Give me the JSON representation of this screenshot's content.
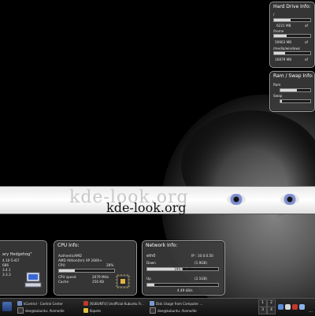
{
  "wallpaper": {
    "ghost_text": "kde-look.org",
    "text": "kde-look.org"
  },
  "hdd": {
    "title": "Hard Drive Info:",
    "rows": [
      {
        "name": "/",
        "value": "6221 MB",
        "unit": "of",
        "fill": 0.45
      },
      {
        "name": "/home",
        "value": "50663 MB",
        "unit": "of",
        "fill": 0.35
      },
      {
        "name": "/media/windows",
        "value": "16879 MB",
        "unit": "of",
        "fill": 0.3
      }
    ]
  },
  "ram": {
    "title": "Ram / Swap Info:",
    "rows": [
      {
        "name": "Ram",
        "fill": 0.55
      },
      {
        "name": "Swap",
        "fill": 0.05
      }
    ]
  },
  "system": {
    "lines": [
      "ary Hedgehog\"",
      "4.10-5-i67",
      "686",
      "3.4.1",
      "3.3.3"
    ]
  },
  "cpu": {
    "title": "CPU Info:",
    "vendor": "AuthenticAMD",
    "model": "AMD Athlon(tm) XP 2600+",
    "usage_label": "CPU",
    "usage_value": "28%",
    "usage_fill": 0.28,
    "speed_label": "CPU speed",
    "speed_value": "2079 MHz",
    "cache_label": "Cache",
    "cache_value": "256 KB"
  },
  "network": {
    "title": "Network Info:",
    "iface": "eth0",
    "ip": "IP : 10.0.0.50",
    "down_label": "Down",
    "down_total": "(1.9GB)",
    "down_rate": "199.99 kB/s",
    "down_fill": 0.5,
    "up_label": "Up",
    "up_total": "(2.1GB)",
    "up_rate": "4.49 kB/s",
    "up_fill": 0.1
  },
  "taskbar": {
    "tasks_top": [
      "kControl - Control Center",
      "[KUBUNTU] Unofficial Kubuntu Fr...",
      "Disk Usage from Computer ..."
    ],
    "tasks_bottom": [
      "dee@kubuntu: /home/de",
      "dee@kubuntu: /home/de",
      "Kopete"
    ],
    "desktops": [
      "1",
      "2",
      "3",
      "4"
    ],
    "clock": "..."
  }
}
